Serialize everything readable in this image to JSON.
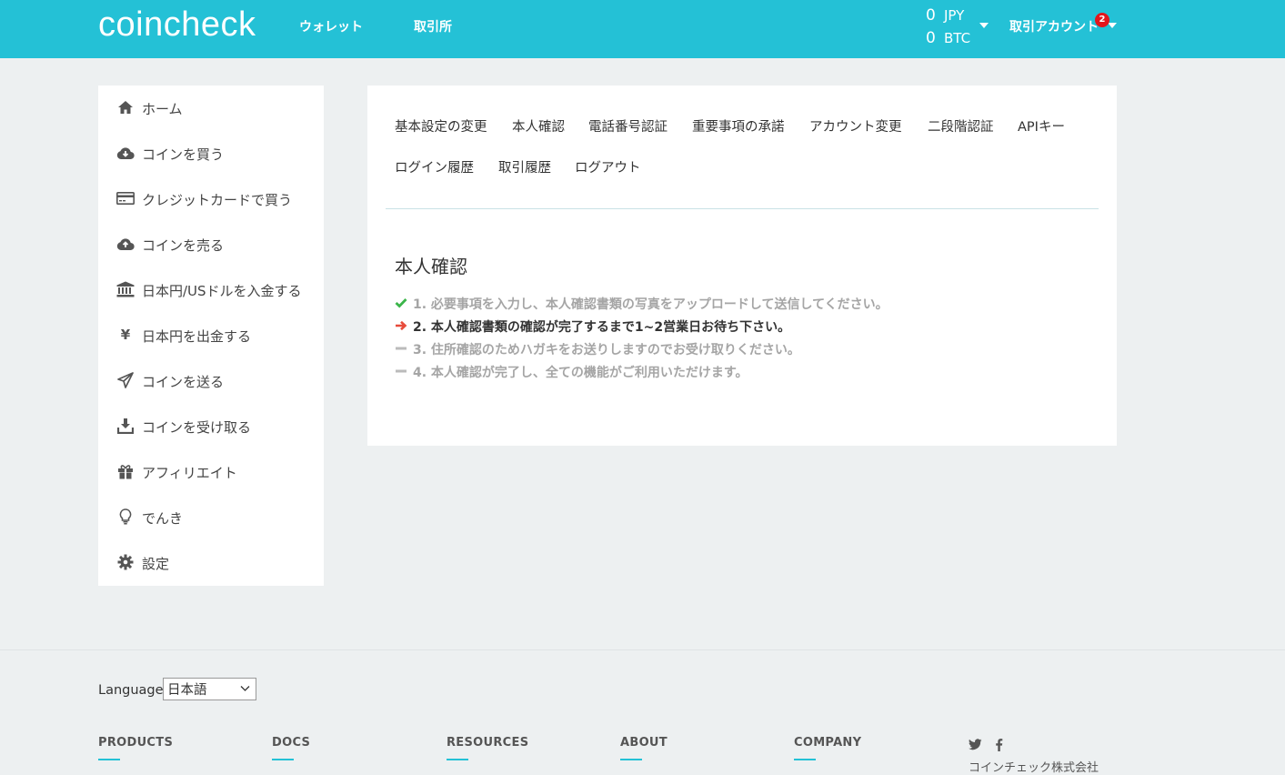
{
  "header": {
    "logo": "coincheck",
    "nav": [
      "ウォレット",
      "取引所"
    ],
    "balances": [
      {
        "amount": "0",
        "unit": "JPY"
      },
      {
        "amount": "0",
        "unit": "BTC"
      }
    ],
    "account_label": "取引アカウント",
    "notification_count": "2",
    "accent_color": "#24c1d6"
  },
  "sidebar": {
    "items": [
      {
        "label": "ホーム",
        "icon": "home-icon"
      },
      {
        "label": "コインを買う",
        "icon": "cloud-download-icon"
      },
      {
        "label": "クレジットカードで買う",
        "icon": "credit-card-icon"
      },
      {
        "label": "コインを売る",
        "icon": "cloud-upload-icon"
      },
      {
        "label": "日本円/USドルを入金する",
        "icon": "bank-icon"
      },
      {
        "label": "日本円を出金する",
        "icon": "yen-icon"
      },
      {
        "label": "コインを送る",
        "icon": "send-icon"
      },
      {
        "label": "コインを受け取る",
        "icon": "download-icon"
      },
      {
        "label": "アフィリエイト",
        "icon": "gift-icon"
      },
      {
        "label": "でんき",
        "icon": "lightbulb-icon"
      },
      {
        "label": "設定",
        "icon": "gear-icon"
      }
    ]
  },
  "main": {
    "tabs_row1": [
      "基本設定の変更",
      "本人確認",
      "電話番号認証",
      "重要事項の承諾",
      "アカウント変更",
      "二段階認証",
      "APIキー"
    ],
    "tabs_row2": [
      "ログイン履歴",
      "取引履歴",
      "ログアウト"
    ],
    "section_title": "本人確認",
    "steps": [
      {
        "text": "1. 必要事項を入力し、本人確認書類の写真をアップロードして送信してください。",
        "status": "done",
        "icon": "check-icon"
      },
      {
        "text": "2. 本人確認書類の確認が完了するまで1~2営業日お待ち下さい。",
        "status": "current",
        "icon": "arrow-right-icon"
      },
      {
        "text": "3. 住所確認のためハガキをお送りしますのでお受け取りください。",
        "status": "pending",
        "icon": "dash-icon"
      },
      {
        "text": "4. 本人確認が完了し、全ての機能がご利用いただけます。",
        "status": "pending",
        "icon": "dash-icon"
      }
    ],
    "status_colors": {
      "done": "#3bb54a",
      "current": "#e74c3c",
      "pending": "#bbbbbb"
    }
  },
  "footer": {
    "language_label": "Language",
    "language_value": "日本語",
    "columns": [
      "PRODUCTS",
      "DOCS",
      "RESOURCES",
      "ABOUT",
      "COMPANY"
    ],
    "company_name": "コインチェック株式会社"
  }
}
